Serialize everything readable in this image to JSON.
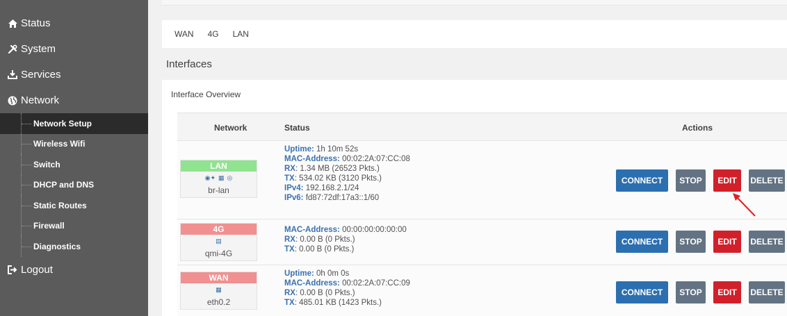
{
  "sidebar": {
    "top_items": [
      {
        "label": "Status",
        "icon": "home-icon"
      },
      {
        "label": "System",
        "icon": "tools-icon"
      },
      {
        "label": "Services",
        "icon": "download-icon"
      },
      {
        "label": "Network",
        "icon": "globe-icon"
      }
    ],
    "sub_items": [
      {
        "label": "Network Setup",
        "active": true
      },
      {
        "label": "Wireless Wifi"
      },
      {
        "label": "Switch"
      },
      {
        "label": "DHCP and DNS"
      },
      {
        "label": "Static Routes"
      },
      {
        "label": "Firewall"
      },
      {
        "label": "Diagnostics"
      }
    ],
    "logout": {
      "label": "Logout",
      "icon": "logout-icon"
    }
  },
  "tabs": [
    "WAN",
    "4G",
    "LAN"
  ],
  "page_title": "Interfaces",
  "panel_title": "Interface Overview",
  "table": {
    "headers": {
      "network": "Network",
      "status": "Status",
      "actions": "Actions"
    },
    "rows": [
      {
        "name": "LAN",
        "color": "#90e38f",
        "ifname": "br-lan",
        "status": [
          {
            "k": "Uptime:",
            "v": " 1h 10m 52s"
          },
          {
            "k": "MAC-Address:",
            "v": " 00:02:2A:07:CC:08"
          },
          {
            "k": "RX",
            "v": ": 1.34 MB (26523 Pkts.)"
          },
          {
            "k": "TX",
            "v": ": 534.02 KB (3120 Pkts.)"
          },
          {
            "k": "IPv4:",
            "v": " 192.168.2.1/24"
          },
          {
            "k": "IPv6:",
            "v": " fd87:72df:17a3::1/60"
          }
        ]
      },
      {
        "name": "4G",
        "color": "#f09090",
        "ifname": "qmi-4G",
        "status": [
          {
            "k": "MAC-Address:",
            "v": " 00:00:00:00:00:00"
          },
          {
            "k": "RX",
            "v": ": 0.00 B (0 Pkts.)"
          },
          {
            "k": "TX",
            "v": ": 0.00 B (0 Pkts.)"
          }
        ]
      },
      {
        "name": "WAN",
        "color": "#f09090",
        "ifname": "eth0.2",
        "status": [
          {
            "k": "Uptime:",
            "v": " 0h 0m 0s"
          },
          {
            "k": "MAC-Address:",
            "v": " 00:02:2A:07:CC:09"
          },
          {
            "k": "RX",
            "v": ": 0.00 B (0 Pkts.)"
          },
          {
            "k": "TX",
            "v": ": 485.01 KB (1423 Pkts.)"
          }
        ]
      }
    ],
    "buttons": {
      "connect": "CONNECT",
      "stop": "STOP",
      "edit": "EDIT",
      "delete": "DELETE"
    }
  },
  "colors": {
    "connect": "#2c6fb0",
    "stop": "#637383",
    "edit": "#d1202a",
    "arrow": "#e02020"
  }
}
